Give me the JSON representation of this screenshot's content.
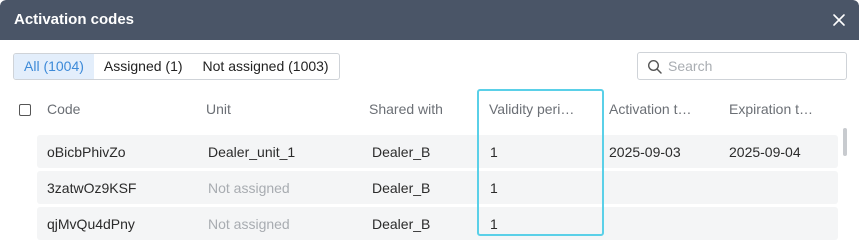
{
  "dialog": {
    "title": "Activation codes"
  },
  "tabs": [
    {
      "label": "All (1004)"
    },
    {
      "label": "Assigned (1)"
    },
    {
      "label": "Not assigned (1003)"
    }
  ],
  "search": {
    "placeholder": "Search",
    "value": ""
  },
  "table": {
    "columns": [
      "Code",
      "Unit",
      "Shared with",
      "Validity peri…",
      "Activation t…",
      "Expiration t…"
    ],
    "rows": [
      {
        "code": "oBicbPhivZo",
        "unit": "Dealer_unit_1",
        "shared": "Dealer_B",
        "validity": "1",
        "activation": "2025-09-03",
        "expiration": "2025-09-04"
      },
      {
        "code": "3zatwOz9KSF",
        "unit": "Not assigned",
        "shared": "Dealer_B",
        "validity": "1",
        "activation": "",
        "expiration": ""
      },
      {
        "code": "qjMvQu4dPny",
        "unit": "Not assigned",
        "shared": "Dealer_B",
        "validity": "1",
        "activation": "",
        "expiration": ""
      }
    ]
  },
  "colors": {
    "titlebar": "#4a5567",
    "accent": "#3d8ad8",
    "highlight": "#5ad0e8"
  },
  "icons": {
    "close": "close-icon",
    "search": "search-icon"
  }
}
